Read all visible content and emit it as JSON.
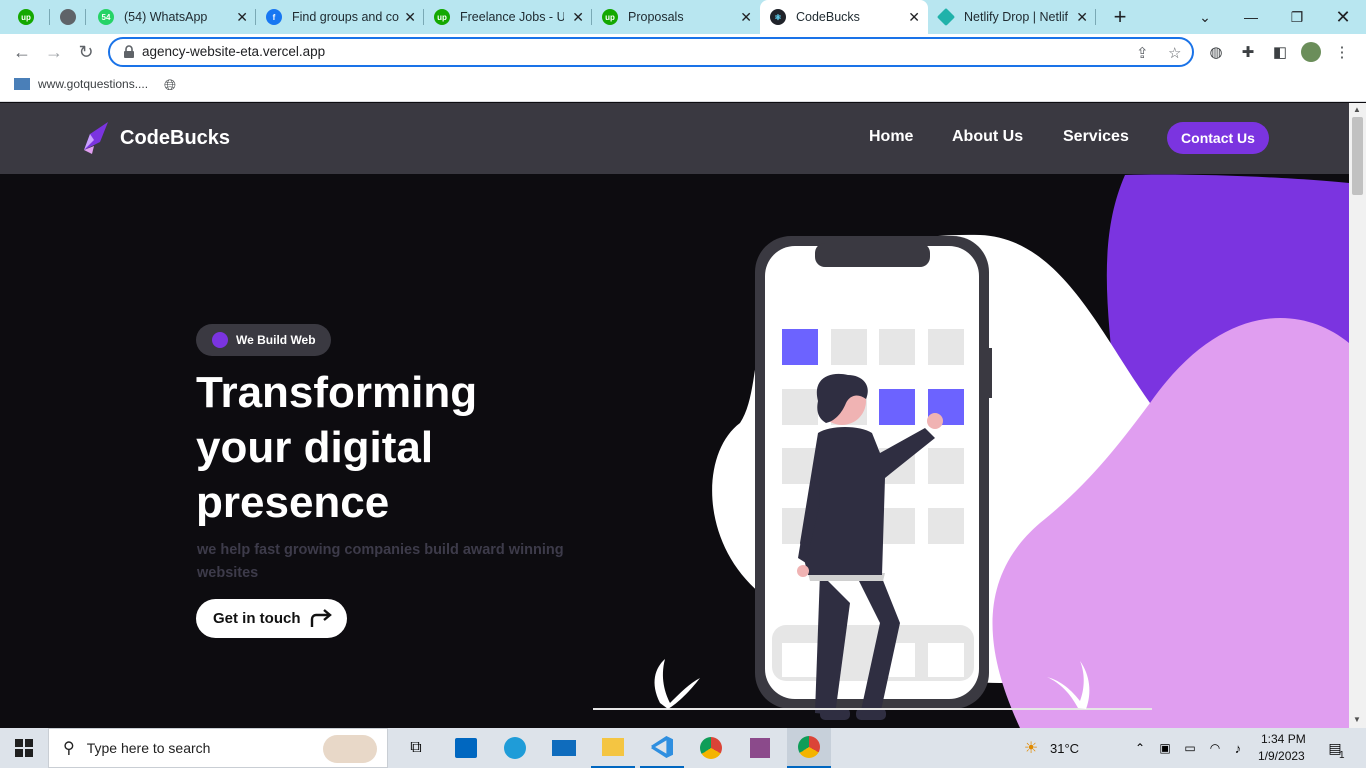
{
  "browser": {
    "tabs": [
      {
        "title": "",
        "favicon": "upwork-icon",
        "favicon_color": "#14a800"
      },
      {
        "title": "",
        "favicon": "globe-icon",
        "favicon_color": "#5f6368"
      },
      {
        "title": "(54) WhatsApp",
        "favicon": "whatsapp-icon",
        "favicon_color": "#25d366",
        "badge": "54"
      },
      {
        "title": "Find groups and co",
        "favicon": "facebook-icon",
        "favicon_color": "#1877f2"
      },
      {
        "title": "Freelance Jobs - Up",
        "favicon": "upwork-icon",
        "favicon_color": "#14a800"
      },
      {
        "title": "Proposals",
        "favicon": "upwork-icon",
        "favicon_color": "#14a800"
      },
      {
        "title": "CodeBucks",
        "favicon": "react-icon",
        "favicon_color": "#61dafb",
        "active": true
      },
      {
        "title": "Netlify Drop | Netlif",
        "favicon": "netlify-icon",
        "favicon_color": "#20b2aa"
      }
    ],
    "url": "agency-website-eta.vercel.app",
    "bookmarks": [
      {
        "label": "www.gotquestions...."
      }
    ]
  },
  "site": {
    "brand": "CodeBucks",
    "nav": {
      "home": "Home",
      "about": "About Us",
      "services": "Services",
      "contact": "Contact Us"
    },
    "hero": {
      "pill": "We Build Web",
      "title_line1": "Transforming",
      "title_line2": "your digital",
      "title_line3": "presence",
      "subtitle": "we help fast growing companies build award winning websites",
      "cta": "Get in touch"
    },
    "colors": {
      "accent": "#7b34e0",
      "header_bg": "#3a3941",
      "page_bg": "#0d0c10",
      "tile_highlight": "#6c63ff",
      "blob_purple": "#7b34e0",
      "blob_pink": "#e09ef0"
    }
  },
  "taskbar": {
    "search_placeholder": "Type here to search",
    "weather": "31°C",
    "time": "1:34 PM",
    "date": "1/9/2023",
    "notifications": "1"
  }
}
